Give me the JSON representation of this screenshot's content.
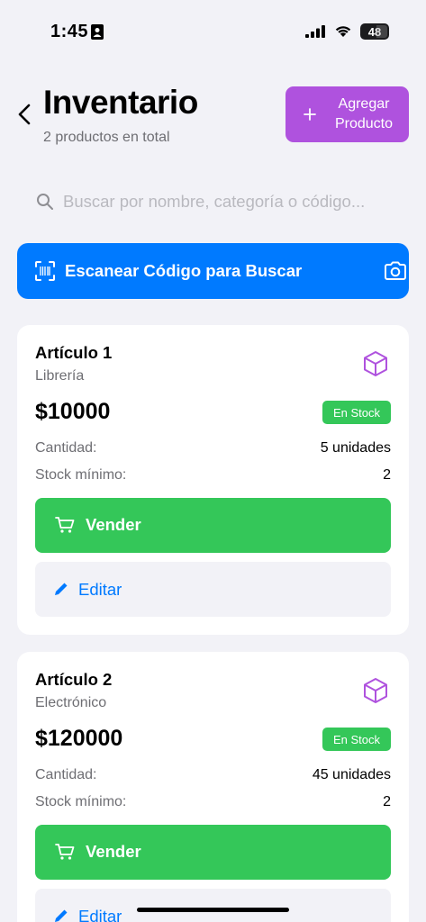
{
  "status_bar": {
    "time": "1:45",
    "battery": "48"
  },
  "header": {
    "title": "Inventario",
    "subtitle": "2 productos en total",
    "add_button_label": "Agregar Producto"
  },
  "search": {
    "placeholder": "Buscar por nombre, categoría o código..."
  },
  "scan_button": {
    "label": "Escanear Código para Buscar"
  },
  "products": [
    {
      "name": "Artículo 1",
      "category": "Librería",
      "price": "$10000",
      "stock_status": "En Stock",
      "quantity_label": "Cantidad:",
      "quantity": "5 unidades",
      "min_stock_label": "Stock mínimo:",
      "min_stock": "2",
      "sell_label": "Vender",
      "edit_label": "Editar"
    },
    {
      "name": "Artículo 2",
      "category": "Electrónico",
      "price": "$120000",
      "stock_status": "En Stock",
      "quantity_label": "Cantidad:",
      "quantity": "45 unidades",
      "min_stock_label": "Stock mínimo:",
      "min_stock": "2",
      "sell_label": "Vender",
      "edit_label": "Editar"
    }
  ],
  "colors": {
    "accent_blue": "#007aff",
    "accent_purple": "#af52de",
    "success_green": "#34c759",
    "background": "#f2f2f7"
  },
  "icons": {
    "back": "chevron-left-icon",
    "add": "plus-icon",
    "search": "search-icon",
    "scan": "barcode-icon",
    "camera": "camera-icon",
    "product": "box-icon",
    "sell": "cart-icon",
    "edit": "pencil-icon"
  }
}
